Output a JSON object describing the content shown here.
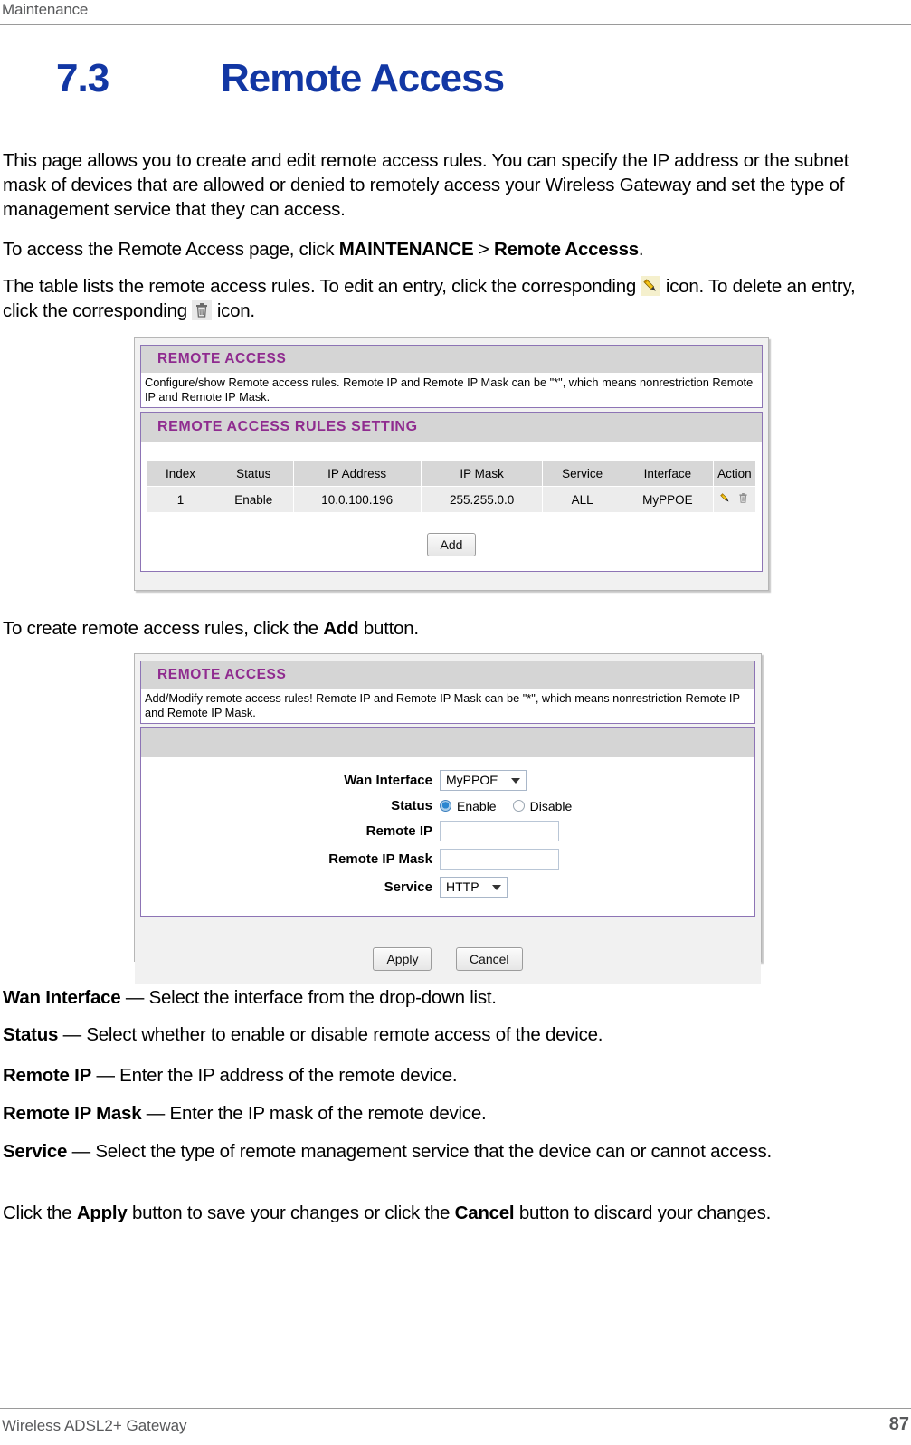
{
  "header": {
    "chapter": "Maintenance"
  },
  "heading": {
    "number": "7.3",
    "title": "Remote Access"
  },
  "paragraphs": {
    "intro": "This page allows you to create and edit remote access rules. You can specify the IP address or the subnet mask of devices that are allowed or denied to remotely access your Wireless Gateway and set the type of management service that they can access.",
    "access_prefix": "To access the Remote Access page, click ",
    "access_bold1": "MAINTENANCE",
    "access_sep": " > ",
    "access_bold2": "Remote Accesss",
    "access_suffix": ".",
    "table_lists_1": "The table lists the remote access rules. To edit an entry, click the corresponding ",
    "table_lists_2": " icon. To delete an entry, click the corresponding ",
    "table_lists_3": " icon.",
    "create_prefix": "To create remote access rules, click the ",
    "create_bold": "Add",
    "create_suffix": " button.",
    "click_apply_1": "Click the ",
    "click_apply_bold1": "Apply",
    "click_apply_2": " button to save your changes or click the ",
    "click_apply_bold2": "Cancel",
    "click_apply_3": " button to discard your changes."
  },
  "definitions": [
    {
      "term": "Wan Interface",
      "dash": " — ",
      "desc": "Select the interface from the drop-down list."
    },
    {
      "term": "Status",
      "dash": " — ",
      "desc": "Select whether to enable or disable remote access of the device."
    },
    {
      "term": "Remote IP",
      "dash": " — ",
      "desc": "Enter the IP address of the remote device."
    },
    {
      "term": "Remote IP Mask",
      "dash": " — ",
      "desc": "Enter the IP mask of the remote device."
    },
    {
      "term": "Service",
      "dash": " — ",
      "desc": "Select the type of remote management service that the device can or cannot access."
    }
  ],
  "screenshot_list": {
    "panel_title": "REMOTE ACCESS",
    "panel_desc": "Configure/show Remote access rules. Remote IP and Remote IP Mask can be \"*\", which means nonrestriction Remote IP and Remote IP Mask.",
    "rules_title": "REMOTE ACCESS RULES SETTING",
    "columns": [
      "Index",
      "Status",
      "IP Address",
      "IP Mask",
      "Service",
      "Interface",
      "Action"
    ],
    "rows": [
      {
        "index": "1",
        "status": "Enable",
        "ip_address": "10.0.100.196",
        "ip_mask": "255.255.0.0",
        "service": "ALL",
        "interface": "MyPPOE",
        "action_edit_icon": "pencil-icon",
        "action_delete_icon": "trash-icon"
      }
    ],
    "add_button": "Add"
  },
  "screenshot_form": {
    "panel_title": "REMOTE ACCESS",
    "panel_desc": "Add/Modify remote access rules! Remote IP and Remote IP Mask can be \"*\", which means nonrestriction Remote IP and Remote IP Mask.",
    "fields": {
      "wan_interface_label": "Wan Interface",
      "wan_interface_value": "MyPPOE",
      "status_label": "Status",
      "status_enable": "Enable",
      "status_disable": "Disable",
      "status_selected": "Enable",
      "remote_ip_label": "Remote IP",
      "remote_ip_value": "",
      "remote_ip_mask_label": "Remote IP Mask",
      "remote_ip_mask_value": "",
      "service_label": "Service",
      "service_value": "HTTP"
    },
    "apply_button": "Apply",
    "cancel_button": "Cancel"
  },
  "footer": {
    "doc_name": "Wireless ADSL2+ Gateway",
    "page_number": "87"
  },
  "colors": {
    "heading_blue": "#1237a4",
    "panel_title_purple": "#8f2b8f",
    "panel_border": "#8d74b5",
    "panel_bar_gray": "#d5d5d5",
    "rule_text_gray": "#58595b"
  }
}
